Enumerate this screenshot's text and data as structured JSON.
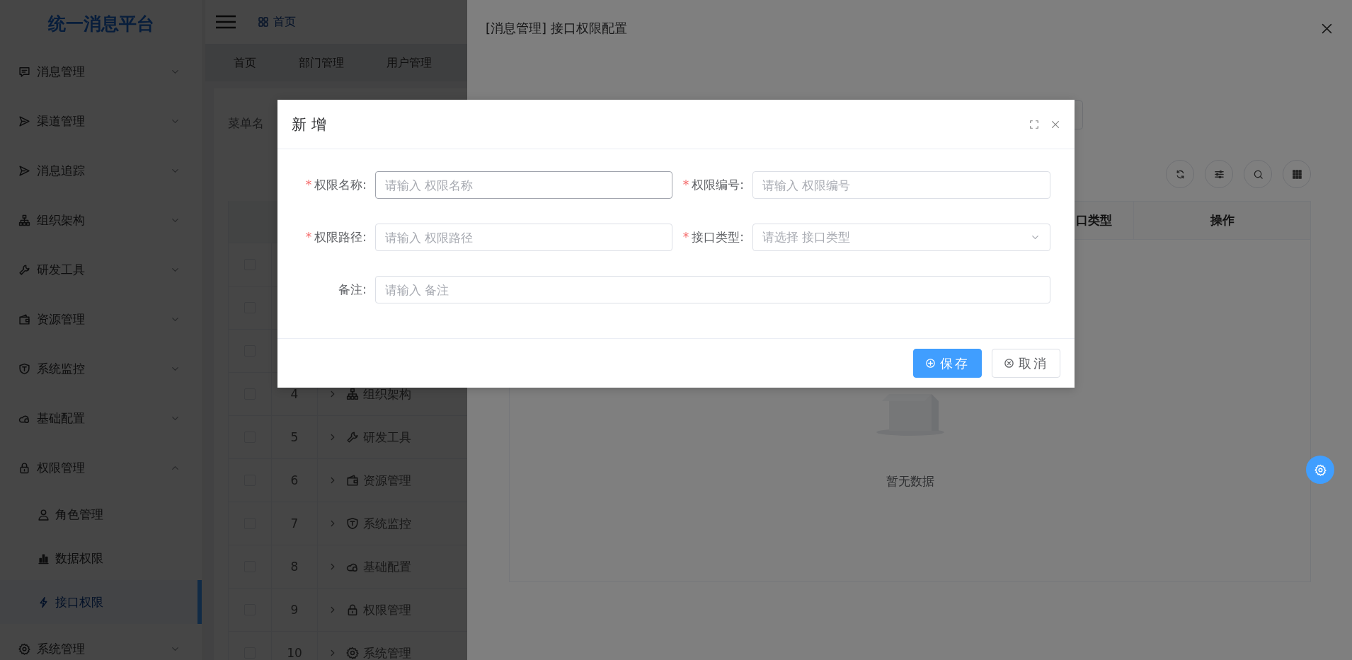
{
  "sidebar": {
    "logo": "统一消息平台",
    "items": [
      {
        "label": "消息管理",
        "expanded": false,
        "selected": false
      },
      {
        "label": "渠道管理",
        "expanded": false,
        "selected": false
      },
      {
        "label": "消息追踪",
        "expanded": false,
        "selected": false
      },
      {
        "label": "组织架构",
        "expanded": false,
        "selected": false
      },
      {
        "label": "研发工具",
        "expanded": false,
        "selected": false
      },
      {
        "label": "资源管理",
        "expanded": false,
        "selected": false
      },
      {
        "label": "系统监控",
        "expanded": false,
        "selected": false
      },
      {
        "label": "基础配置",
        "expanded": false,
        "selected": false
      },
      {
        "label": "权限管理",
        "expanded": true,
        "selected": false,
        "children": [
          {
            "label": "角色管理",
            "selected": false
          },
          {
            "label": "数据权限",
            "selected": false
          },
          {
            "label": "接口权限",
            "selected": true
          }
        ]
      },
      {
        "label": "系统管理",
        "expanded": false,
        "selected": false
      }
    ]
  },
  "header": {
    "breadcrumb": "首页"
  },
  "tabs": [
    {
      "label": "首页",
      "selected": false
    },
    {
      "label": "部门管理",
      "selected": false
    },
    {
      "label": "用户管理",
      "selected": false
    }
  ],
  "menu_page": {
    "search_label": "菜单名",
    "rows": [
      {
        "checked": false
      },
      {
        "checked": false
      },
      {
        "checked": false
      },
      {
        "checked": false,
        "index": "4",
        "name": "组织架构"
      },
      {
        "checked": false,
        "index": "5",
        "name": "研发工具"
      },
      {
        "checked": false,
        "index": "6",
        "name": "资源管理"
      },
      {
        "checked": false,
        "index": "7",
        "name": "系统监控"
      },
      {
        "checked": false,
        "index": "8",
        "name": "基础配置"
      },
      {
        "checked": false,
        "index": "9",
        "name": "权限管理"
      },
      {
        "checked": false,
        "index": "10",
        "name": "系统管理"
      }
    ]
  },
  "drawer": {
    "title": "[消息管理] 接口权限配置",
    "columns": [
      "口类型",
      "操作"
    ],
    "empty_text": "暂无数据"
  },
  "dialog": {
    "title": "新 增",
    "required_mark": "*",
    "fields": [
      {
        "label": "权限名称:",
        "kind": "input",
        "required": true,
        "placeholder": "请输入 权限名称",
        "focused": true
      },
      {
        "label": "权限编号:",
        "kind": "input",
        "required": true,
        "placeholder": "请输入 权限编号",
        "focused": false
      },
      {
        "label": "权限路径:",
        "kind": "input",
        "required": true,
        "placeholder": "请输入 权限路径",
        "focused": false
      },
      {
        "label": "接口类型:",
        "kind": "select",
        "required": true,
        "placeholder": "请选择 接口类型",
        "focused": false
      },
      {
        "label": "备注:",
        "kind": "wide",
        "required": false,
        "placeholder": "请输入 备注",
        "focused": false
      }
    ],
    "buttons": [
      {
        "label": "保存",
        "kind": "primary"
      },
      {
        "label": "取消",
        "kind": "default"
      }
    ]
  }
}
